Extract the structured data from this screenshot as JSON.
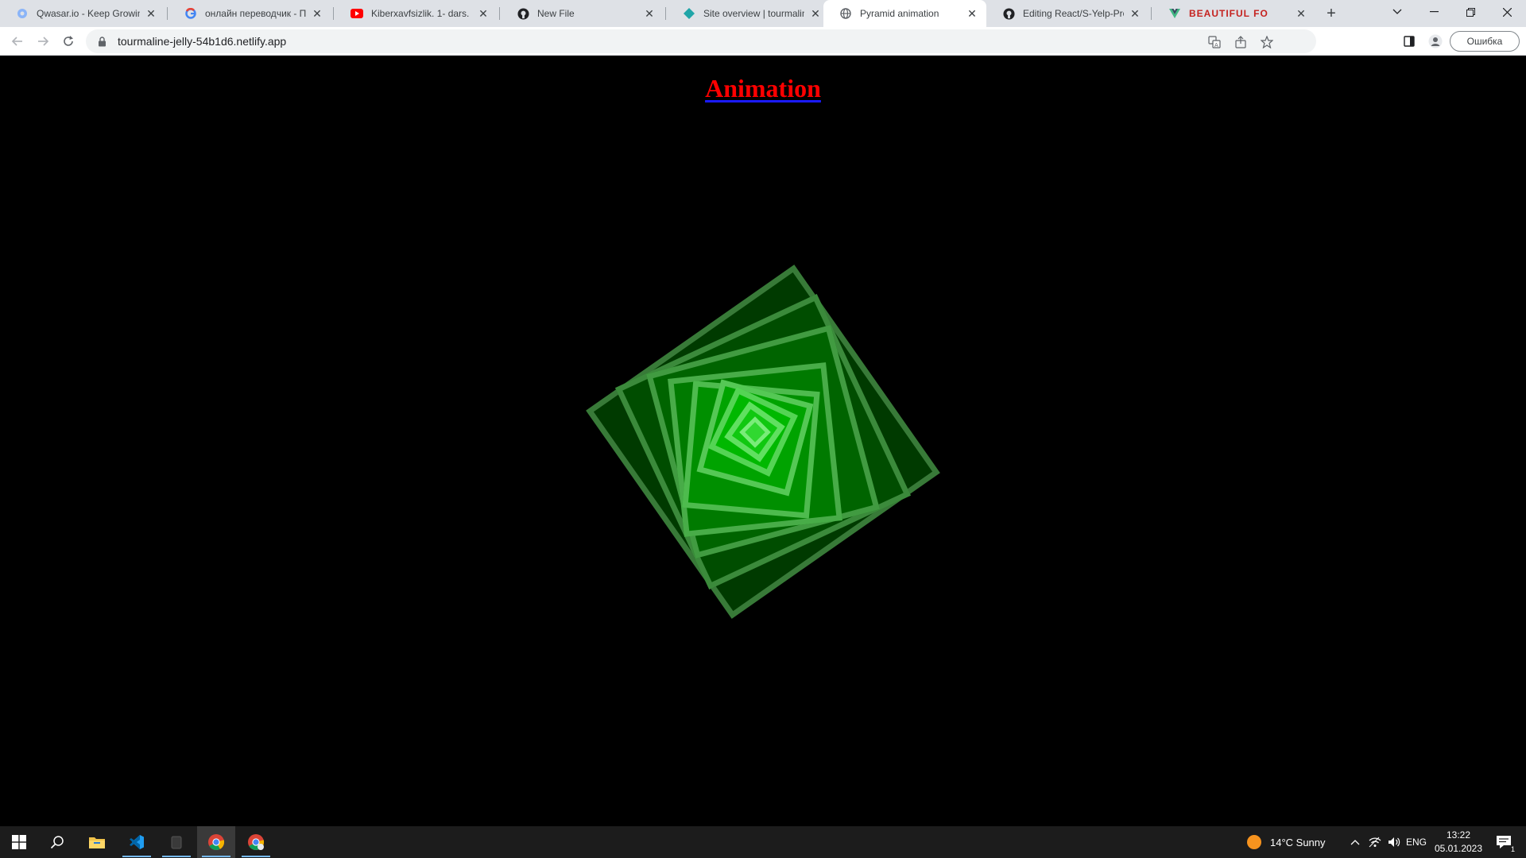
{
  "browser": {
    "tabs": [
      {
        "title": "Qwasar.io - Keep Growing",
        "favicon": "qwasar-icon",
        "active": false
      },
      {
        "title": "онлайн переводчик - Пои",
        "favicon": "google-icon",
        "active": false
      },
      {
        "title": "Kiberxavfsizlik. 1- dars. Kib",
        "favicon": "youtube-icon",
        "active": false
      },
      {
        "title": "New File",
        "favicon": "github-icon",
        "active": false
      },
      {
        "title": "Site overview | tourmaline",
        "favicon": "netlify-icon",
        "active": false
      },
      {
        "title": "Pyramid animation",
        "favicon": "globe-icon",
        "active": true
      },
      {
        "title": "Editing React/S-Yelp-Proje",
        "favicon": "github-icon",
        "active": false
      },
      {
        "title": "BEAUTIFUL FO",
        "favicon": "vue-icon",
        "active": false
      }
    ],
    "address": {
      "url": "tourmaline-jelly-54b1d6.netlify.app"
    },
    "profile_label": "Ошибка"
  },
  "page": {
    "heading": "Animation"
  },
  "taskbar": {
    "weather": "14°C  Sunny",
    "language": "ENG",
    "time": "13:22",
    "date": "05.01.2023",
    "notification_count": "1"
  },
  "colors": {
    "heading": "#ff0000",
    "heading_underline": "#1a1aff",
    "square_border": "#5ac85a",
    "accent": "#76b9ed"
  }
}
